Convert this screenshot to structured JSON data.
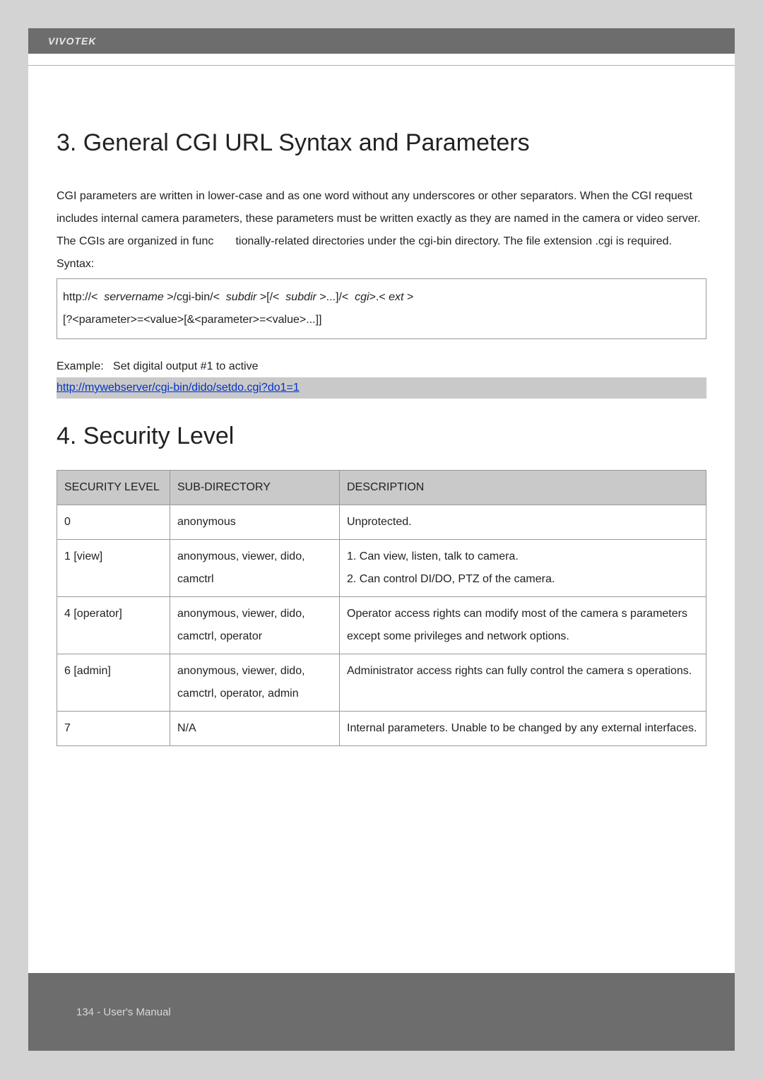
{
  "brand": "VIVOTEK",
  "section3": {
    "heading": "3. General CGI URL Syntax and Parameters",
    "para": "CGI parameters are written in lower-case and as one word without any underscores or other separators. When the CGI request includes internal camera parameters, these parameters must be written exactly as they are named in the camera or video server. The CGIs are organized in func       tionally-related directories under the cgi-bin directory. The file extension .cgi is required.",
    "syntax_label": "Syntax:",
    "syntax_line1_pre": "http://<  ",
    "syntax_line1_i1": "servername",
    "syntax_line1_mid1": " >/cgi-bin/<  ",
    "syntax_line1_i2": "subdir",
    "syntax_line1_mid2": " >[/<  ",
    "syntax_line1_i3": "subdir",
    "syntax_line1_mid3": " >...]/<  ",
    "syntax_line1_i4": "cgi",
    "syntax_line1_mid4": ">.< ",
    "syntax_line1_i5": "ext",
    "syntax_line1_end": " >",
    "syntax_line2": "[?<parameter>=<value>[&<parameter>=<value>...]]",
    "example_label": "Example:   Set digital output #1 to active",
    "example_link": "http://mywebserver/cgi-bin/dido/setdo.cgi?do1=1"
  },
  "section4": {
    "heading": "4. Security Level",
    "headers": {
      "c1": "SECURITY LEVEL",
      "c2": "SUB-DIRECTORY",
      "c3": "DESCRIPTION"
    },
    "rows": [
      {
        "level": "0",
        "subdir": "anonymous",
        "desc": "Unprotected."
      },
      {
        "level": "1 [view]",
        "subdir": "anonymous, viewer, dido, camctrl",
        "desc": "1. Can view, listen, talk to camera.\n2. Can control DI/DO, PTZ of the camera."
      },
      {
        "level": "4 [operator]",
        "subdir": "anonymous, viewer, dido, camctrl, operator",
        "desc": "Operator access rights can modify most of the camera s parameters except some privileges and network options."
      },
      {
        "level": "6 [admin]",
        "subdir": "anonymous, viewer, dido, camctrl, operator, admin",
        "desc": "Administrator access rights can fully control the camera s operations."
      },
      {
        "level": "7",
        "subdir": "N/A",
        "desc": "Internal parameters. Unable to be changed by any external interfaces."
      }
    ]
  },
  "footer": "134 - User's Manual"
}
